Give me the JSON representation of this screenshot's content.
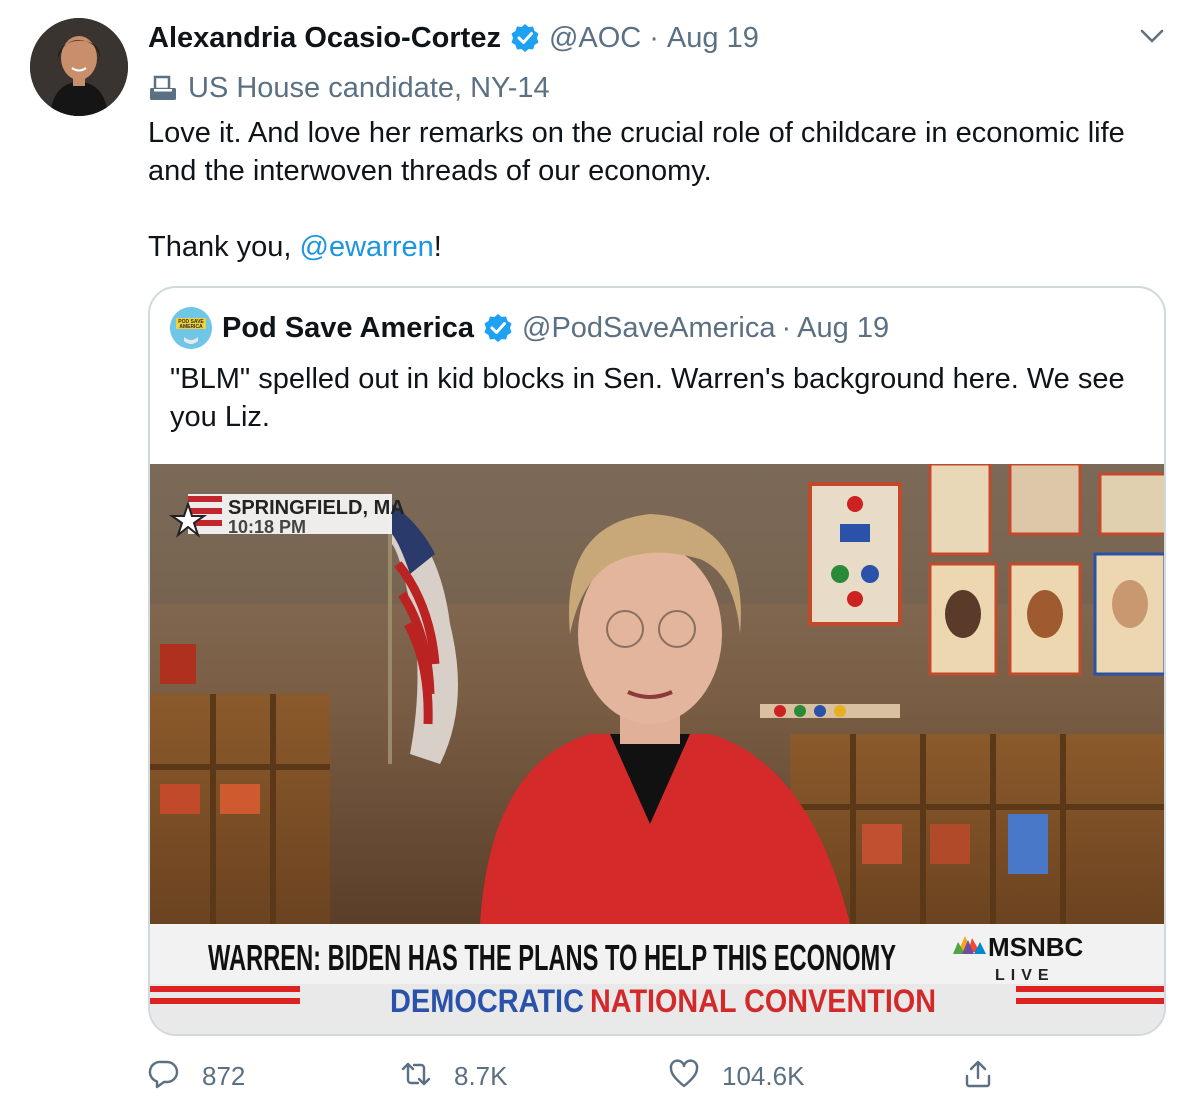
{
  "author": {
    "name": "Alexandria Ocasio-Cortez",
    "handle": "@AOC",
    "separator": "·",
    "date": "Aug 19",
    "label": "US House candidate, NY-14"
  },
  "tweet": {
    "line1": "Love it. And love her remarks on the crucial role of childcare in economic life and the interwoven threads of our economy.",
    "thanks_prefix": "Thank you, ",
    "mention": "@ewarren",
    "thanks_suffix": "!"
  },
  "quoted": {
    "name": "Pod Save America",
    "handle": "@PodSaveAmerica",
    "separator": "·",
    "date": "Aug 19",
    "text": "\"BLM\" spelled out in kid blocks in Sen. Warren's background here. We see you Liz.",
    "avatar_text": "POD SAVE AMERICA"
  },
  "media": {
    "location": "SPRINGFIELD, MA",
    "time": "10:18 PM",
    "headline": "WARREN: BIDEN HAS THE PLANS TO HELP THIS ECONOMY",
    "network": "MSNBC",
    "live": "LIVE",
    "banner_left": "DEMOCRATIC",
    "banner_right": "NATIONAL CONVENTION"
  },
  "actions": {
    "replies": "872",
    "retweets": "8.7K",
    "likes": "104.6K"
  },
  "colors": {
    "link": "#1b95e0",
    "secondary": "#5b7083",
    "verified": "#1da1f2",
    "border": "#cfd9de"
  }
}
